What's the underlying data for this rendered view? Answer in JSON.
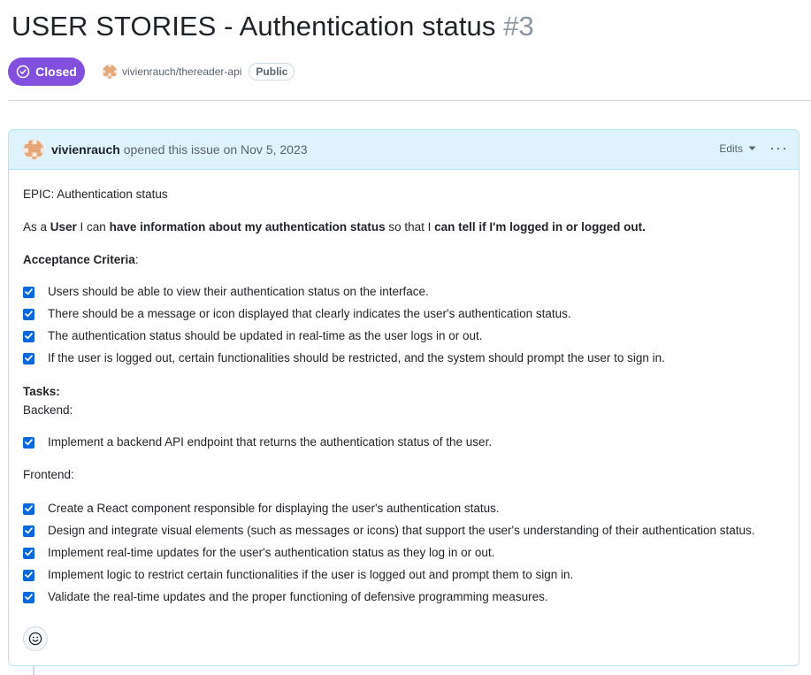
{
  "issue": {
    "title": "USER STORIES - Authentication status",
    "number": "#3",
    "state": "Closed",
    "repo": "vivienrauch/thereader-api",
    "visibility": "Public"
  },
  "comment": {
    "author": "vivienrauch",
    "action": "opened this issue on Nov 5, 2023",
    "edits_label": "Edits",
    "more_label": "···",
    "epic": "EPIC: Authentication status",
    "story": {
      "p1": "As a ",
      "p2": "User",
      "p3": " I can ",
      "p4": "have information about my authentication status",
      "p5": " so that I ",
      "p6": "can tell if I'm logged in or logged out."
    },
    "acceptance_heading": "Acceptance Criteria",
    "acceptance_colon": ":",
    "acceptance": [
      "Users should be able to view their authentication status on the interface.",
      "There should be a message or icon displayed that clearly indicates the user's authentication status.",
      "The authentication status should be updated in real-time as the user logs in or out.",
      "If the user is logged out, certain functionalities should be restricted, and the system should prompt the user to sign in."
    ],
    "tasks_heading": "Tasks:",
    "backend_heading": "Backend:",
    "backend": [
      "Implement a backend API endpoint that returns the authentication status of the user."
    ],
    "frontend_heading": "Frontend:",
    "frontend": [
      "Create a React component responsible for displaying the user's authentication status.",
      "Design and integrate visual elements (such as messages or icons) that support the user's understanding of their authentication status.",
      "Implement real-time updates for the user's authentication status as they log in or out.",
      "Implement logic to restrict certain functionalities if the user is logged out and prompt them to sign in.",
      "Validate the real-time updates and the proper functioning of defensive programming measures."
    ]
  },
  "colors": {
    "closed_purple": "#8250df",
    "header_blue": "#ddf4ff",
    "checkbox_blue": "#0969da"
  },
  "icons": {
    "state": "check-circle-icon",
    "edits": "chevron-down-icon",
    "more": "kebab-horizontal-icon",
    "reaction": "smiley-icon"
  }
}
